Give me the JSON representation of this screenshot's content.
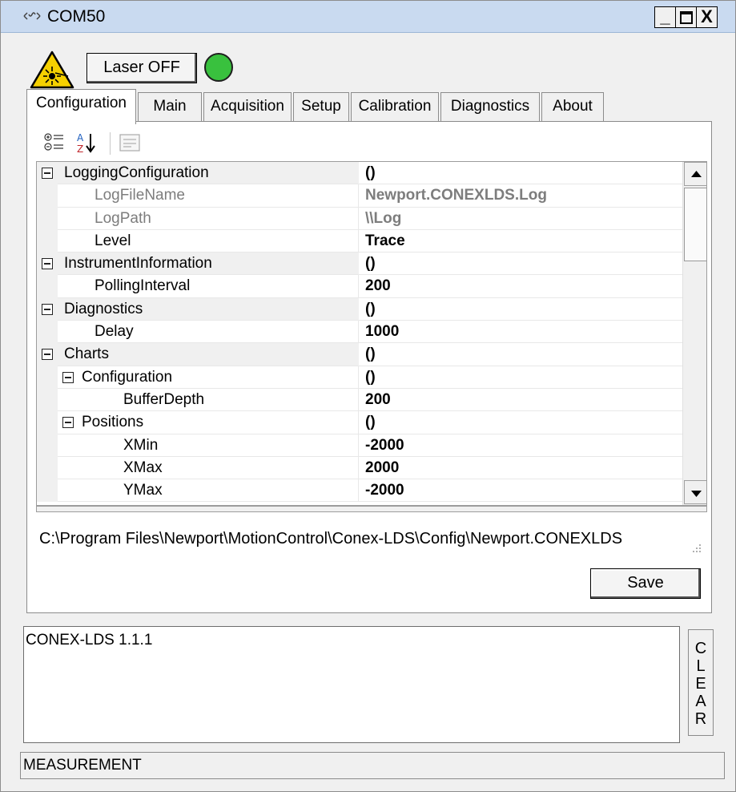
{
  "window": {
    "title": "COM50",
    "minimize": "_",
    "close": "X",
    "title_icon": "serial-port-icon",
    "titlebar_color": "#c9daf0"
  },
  "header": {
    "laser_warning_icon": "laser-warning-icon",
    "laser_button": "Laser OFF",
    "status_led_color": "#39c13e"
  },
  "tabs": [
    {
      "label": "Configuration",
      "active": true
    },
    {
      "label": "Main"
    },
    {
      "label": "Acquisition"
    },
    {
      "label": "Setup"
    },
    {
      "label": "Calibration"
    },
    {
      "label": "Diagnostics"
    },
    {
      "label": "About"
    }
  ],
  "propertygrid": {
    "toolbar": {
      "categorized_icon": "categorized-icon",
      "alphabetical_icon": "sort-az-icon",
      "property_pages_icon": "property-pages-icon"
    },
    "rows": [
      {
        "name": "LoggingConfiguration",
        "value": "()",
        "category": true
      },
      {
        "name": "LogFileName",
        "value": "Newport.CONEXLDS.Log",
        "readonly": true
      },
      {
        "name": "LogPath",
        "value": "\\\\Log",
        "readonly": true
      },
      {
        "name": "Level",
        "value": "Trace"
      },
      {
        "name": "InstrumentInformation",
        "value": "()",
        "category": true
      },
      {
        "name": "PollingInterval",
        "value": "200"
      },
      {
        "name": "Diagnostics",
        "value": "()",
        "category": true
      },
      {
        "name": "Delay",
        "value": "1000"
      },
      {
        "name": "Charts",
        "value": "()",
        "category": true
      },
      {
        "name": "Configuration",
        "value": "()",
        "expandable": true
      },
      {
        "name": "BufferDepth",
        "value": "200"
      },
      {
        "name": "Positions",
        "value": "()",
        "expandable": true
      },
      {
        "name": "XMin",
        "value": "-2000"
      },
      {
        "name": "XMax",
        "value": "2000"
      },
      {
        "name": "YMax",
        "value": "-2000"
      }
    ]
  },
  "config_path": "C:\\Program Files\\Newport\\MotionControl\\Conex-LDS\\Config\\Newport.CONEXLDS",
  "save_button": "Save",
  "log_text": "CONEX-LDS 1.1.1",
  "clear_button_letters": [
    "C",
    "L",
    "E",
    "A",
    "R"
  ],
  "status_text": "MEASUREMENT"
}
